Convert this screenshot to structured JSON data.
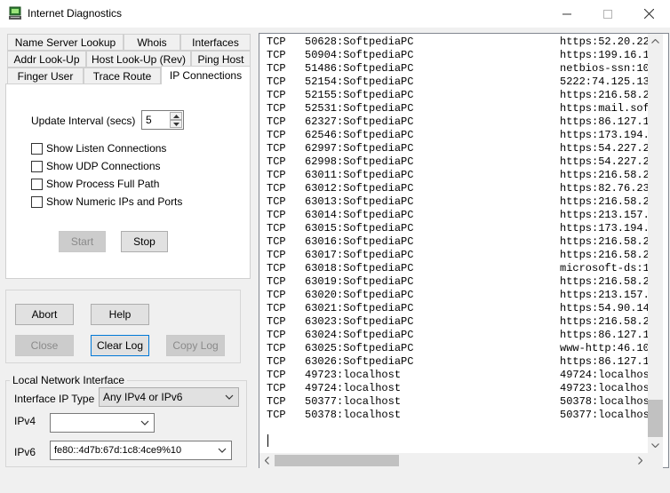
{
  "window": {
    "title": "Internet Diagnostics"
  },
  "tabs": {
    "row1": [
      "Name Server Lookup",
      "Whois",
      "Interfaces"
    ],
    "row2": [
      "Addr Look-Up",
      "Host Look-Up (Rev)",
      "Ping Host"
    ],
    "row3": [
      "Finger User",
      "Trace Route",
      "IP Connections"
    ]
  },
  "ip_connections": {
    "update_interval_label": "Update Interval (secs)",
    "update_interval_value": "5",
    "options": [
      {
        "label": "Show Listen Connections",
        "checked": false
      },
      {
        "label": "Show UDP Connections",
        "checked": false
      },
      {
        "label": "Show Process Full Path",
        "checked": false
      },
      {
        "label": "Show Numeric IPs and Ports",
        "checked": false
      }
    ],
    "start_label": "Start",
    "stop_label": "Stop"
  },
  "actions": {
    "abort": "Abort",
    "help": "Help",
    "close": "Close",
    "clear_log": "Clear Log",
    "copy_log": "Copy Log"
  },
  "local_network": {
    "title": "Local Network Interface",
    "ip_type_label": "Interface IP Type",
    "ip_type_value": "Any IPv4 or IPv6",
    "ipv4_label": "IPv4",
    "ipv4_value": "",
    "ipv6_label": "IPv6",
    "ipv6_value": "fe80::4d7b:67d:1c8:4ce9%10"
  },
  "connections": [
    {
      "proto": "TCP",
      "local": "50628:SoftpediaPC",
      "remote": "https:52.20.22"
    },
    {
      "proto": "TCP",
      "local": "50904:SoftpediaPC",
      "remote": "https:199.16.1"
    },
    {
      "proto": "TCP",
      "local": "51486:SoftpediaPC",
      "remote": "netbios-ssn:10"
    },
    {
      "proto": "TCP",
      "local": "52154:SoftpediaPC",
      "remote": "5222:74.125.13"
    },
    {
      "proto": "TCP",
      "local": "52155:SoftpediaPC",
      "remote": "https:216.58.2"
    },
    {
      "proto": "TCP",
      "local": "52531:SoftpediaPC",
      "remote": "https:mail.sof"
    },
    {
      "proto": "TCP",
      "local": "62327:SoftpediaPC",
      "remote": "https:86.127.1"
    },
    {
      "proto": "TCP",
      "local": "62546:SoftpediaPC",
      "remote": "https:173.194."
    },
    {
      "proto": "TCP",
      "local": "62997:SoftpediaPC",
      "remote": "https:54.227.2"
    },
    {
      "proto": "TCP",
      "local": "62998:SoftpediaPC",
      "remote": "https:54.227.2"
    },
    {
      "proto": "TCP",
      "local": "63011:SoftpediaPC",
      "remote": "https:216.58.2"
    },
    {
      "proto": "TCP",
      "local": "63012:SoftpediaPC",
      "remote": "https:82.76.23"
    },
    {
      "proto": "TCP",
      "local": "63013:SoftpediaPC",
      "remote": "https:216.58.2"
    },
    {
      "proto": "TCP",
      "local": "63014:SoftpediaPC",
      "remote": "https:213.157."
    },
    {
      "proto": "TCP",
      "local": "63015:SoftpediaPC",
      "remote": "https:173.194."
    },
    {
      "proto": "TCP",
      "local": "63016:SoftpediaPC",
      "remote": "https:216.58.2"
    },
    {
      "proto": "TCP",
      "local": "63017:SoftpediaPC",
      "remote": "https:216.58.2"
    },
    {
      "proto": "TCP",
      "local": "63018:SoftpediaPC",
      "remote": "microsoft-ds:1"
    },
    {
      "proto": "TCP",
      "local": "63019:SoftpediaPC",
      "remote": "https:216.58.2"
    },
    {
      "proto": "TCP",
      "local": "63020:SoftpediaPC",
      "remote": "https:213.157."
    },
    {
      "proto": "TCP",
      "local": "63021:SoftpediaPC",
      "remote": "https:54.90.14"
    },
    {
      "proto": "TCP",
      "local": "63023:SoftpediaPC",
      "remote": "https:216.58.2"
    },
    {
      "proto": "TCP",
      "local": "63024:SoftpediaPC",
      "remote": "https:86.127.1"
    },
    {
      "proto": "TCP",
      "local": "63025:SoftpediaPC",
      "remote": "www-http:46.10"
    },
    {
      "proto": "TCP",
      "local": "63026:SoftpediaPC",
      "remote": "https:86.127.1"
    },
    {
      "proto": "TCP",
      "local": "49723:localhost",
      "remote": "49724:localhos"
    },
    {
      "proto": "TCP",
      "local": "49724:localhost",
      "remote": "49723:localhos"
    },
    {
      "proto": "TCP",
      "local": "50377:localhost",
      "remote": "50378:localhos"
    },
    {
      "proto": "TCP",
      "local": "50378:localhost",
      "remote": "50377:localhos"
    }
  ]
}
